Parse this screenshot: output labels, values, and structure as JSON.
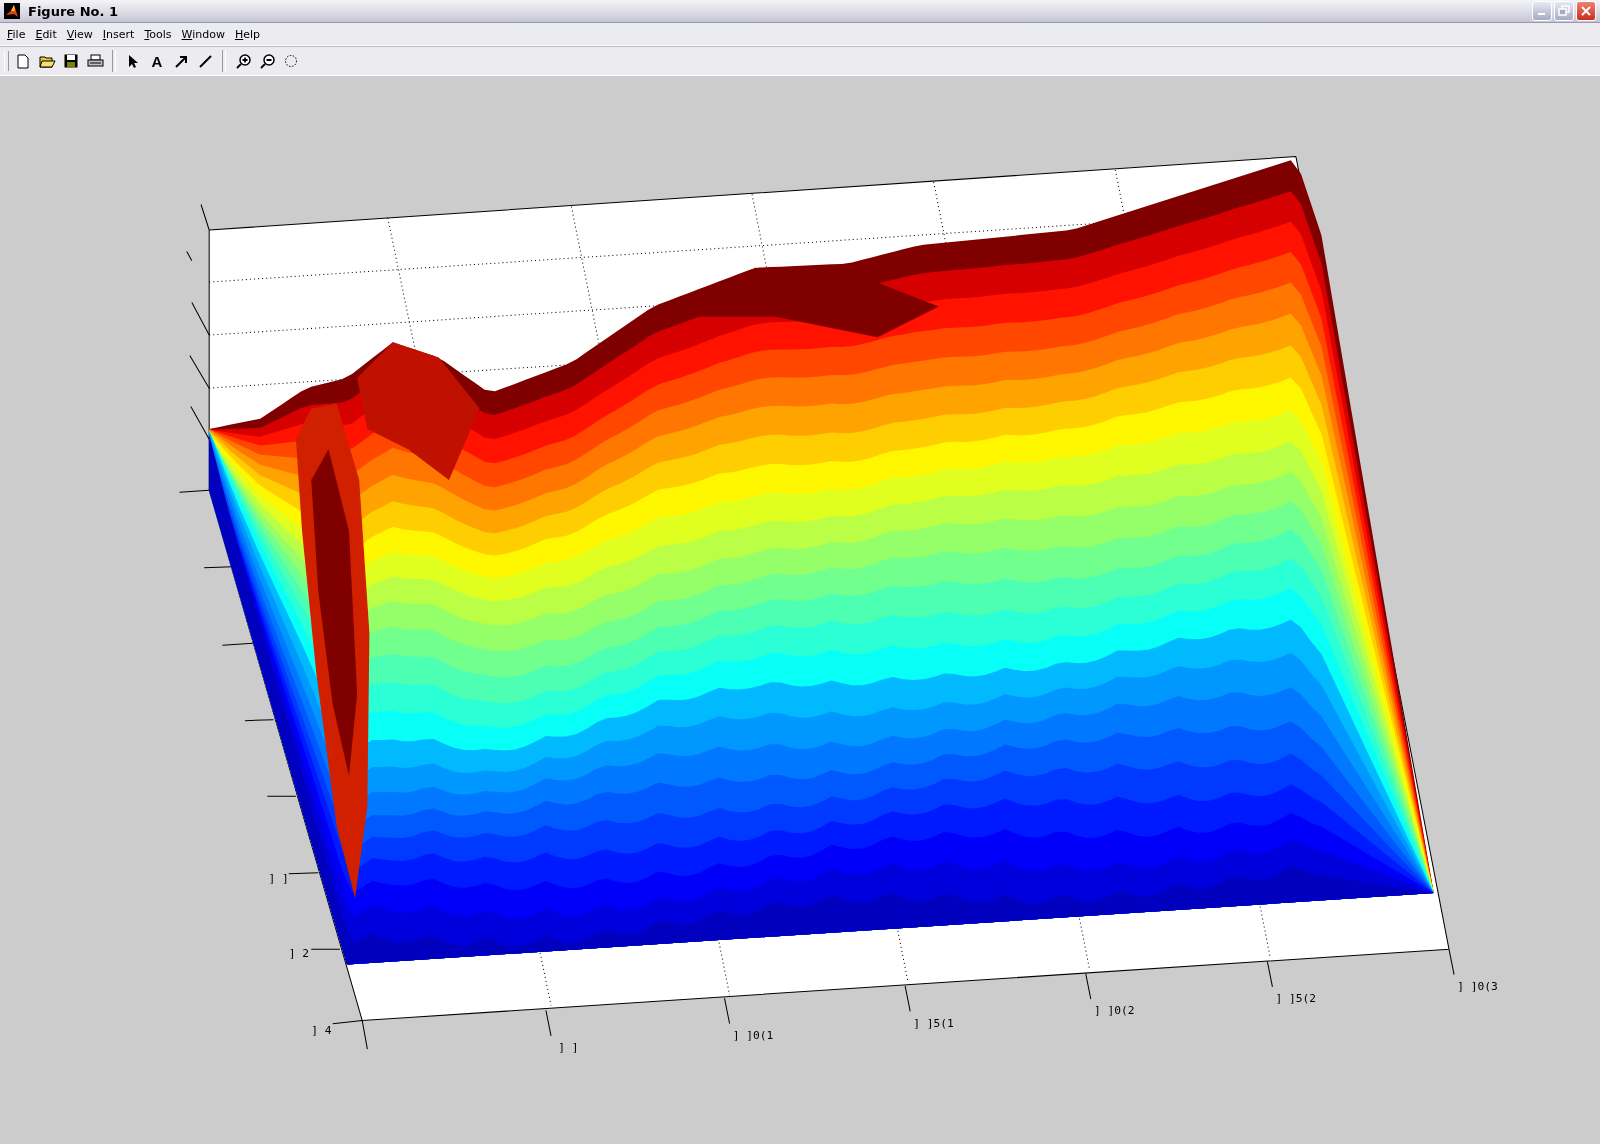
{
  "window": {
    "title": "Figure No. 1"
  },
  "menu": [
    "File",
    "Edit",
    "View",
    "Insert",
    "Tools",
    "Window",
    "Help"
  ],
  "toolbar": [
    {
      "kind": "new"
    },
    {
      "kind": "open"
    },
    {
      "kind": "save"
    },
    {
      "kind": "print"
    },
    {
      "kind": "separator"
    },
    {
      "kind": "pointer"
    },
    {
      "kind": "text",
      "label": "A"
    },
    {
      "kind": "arrow"
    },
    {
      "kind": "line"
    },
    {
      "kind": "separator"
    },
    {
      "kind": "zoom-in"
    },
    {
      "kind": "zoom-out"
    },
    {
      "kind": "rotate"
    }
  ],
  "axes": {
    "y_tick_labels": [
      "] ]",
      "] 2",
      "] 4"
    ],
    "x_tick_labels": [
      "] ]",
      "] ]0(1",
      "] ]5(1",
      "] ]0(2",
      "] ]5(2",
      "] ]0(3"
    ]
  }
}
